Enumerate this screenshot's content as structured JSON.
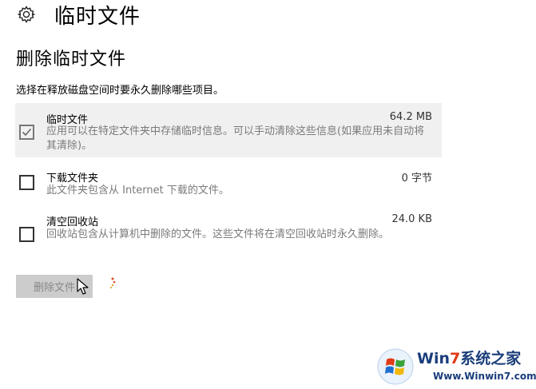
{
  "header": {
    "icon": "gear-icon",
    "title": "临时文件"
  },
  "section": {
    "title": "删除临时文件",
    "description": "选择在释放磁盘空间时要永久删除哪些项目。"
  },
  "items": [
    {
      "name": "临时文件",
      "size": "64.2 MB",
      "detail": "应用可以在特定文件夹中存储临时信息。可以手动清除这些信息(如果应用未自动将其清除)。",
      "checked": true
    },
    {
      "name": "下载文件夹",
      "size": "0 字节",
      "detail": "此文件夹包含从 Internet 下载的文件。",
      "checked": false
    },
    {
      "name": "清空回收站",
      "size": "24.0 KB",
      "detail": "回收站包含从计算机中删除的文件。这些文件将在清空回收站时永久删除。",
      "checked": false
    }
  ],
  "actions": {
    "delete_label": "删除文件"
  },
  "watermark": {
    "title_prefix": "Win",
    "title_seven": "7",
    "title_suffix": "系统之家",
    "url": "Www.Winwin7.com"
  },
  "colors": {
    "selected_row": "#f0f0f0",
    "disabled_button": "#cccccc",
    "detail_text": "#7a7a7a",
    "watermark_blue": "#1a3d7a",
    "watermark_red": "#e23a16"
  }
}
